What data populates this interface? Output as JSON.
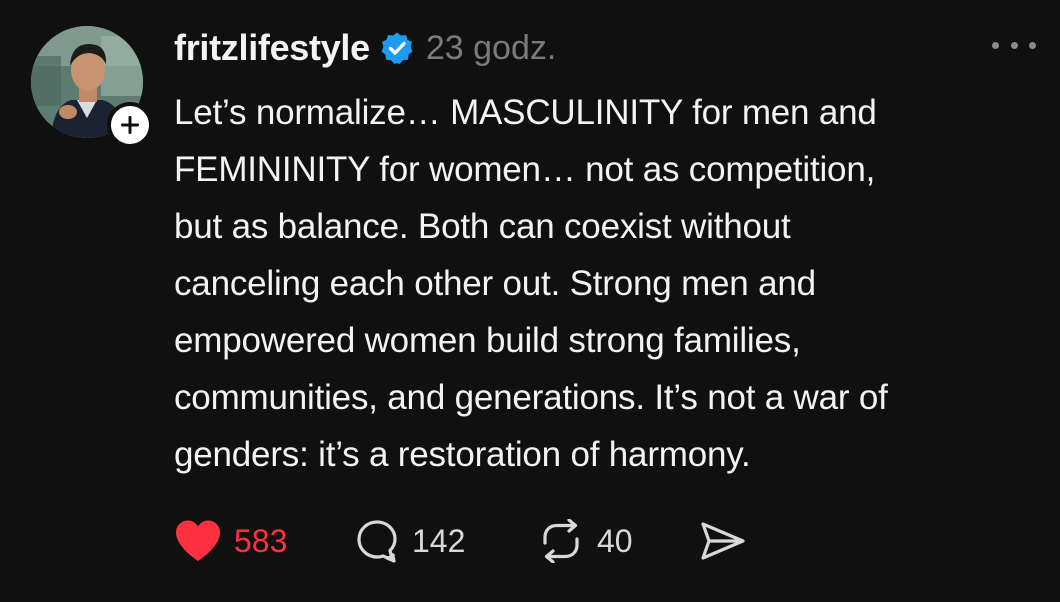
{
  "post": {
    "username": "fritzlifestyle",
    "time": "23 godz.",
    "text_lines": [
      "Let’s normalize… MASCULINITY for men and",
      "FEMININITY for women… not as competition,",
      "but as balance. Both can coexist without",
      "canceling each other out. Strong men and",
      "empowered women build strong families,",
      "communities, and generations. It’s not a war of",
      "genders: it’s a restoration of harmony."
    ],
    "actions": {
      "likes": "583",
      "comments": "142",
      "reposts": "40"
    },
    "liked": true
  },
  "icons": {
    "verified": "verified-badge-icon",
    "follow": "plus-icon",
    "more": "more-horizontal-icon",
    "like": "heart-filled-icon",
    "comment": "comment-bubble-icon",
    "repost": "repost-icon",
    "share": "send-icon"
  },
  "colors": {
    "background": "#101010",
    "text": "#f3f3f3",
    "muted": "#7a7a7a",
    "verified": "#1d9bf0",
    "like": "#ff3040"
  }
}
